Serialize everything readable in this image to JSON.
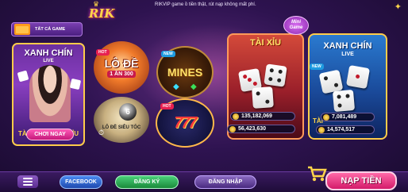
{
  "header": {
    "logo_text": "RIK",
    "ticker": "RIKVIP game ồ tiền thật, rút nạp không mất phí."
  },
  "tabs": {
    "all_games": "TẤT CẢ GAME"
  },
  "games": {
    "xanh_chin_live": {
      "title": "XANH CHÍN",
      "subtitle": "LIVE",
      "tai": "TÀI",
      "xiu": "XỈU",
      "play": "CHƠI NGAY"
    },
    "lo_de": {
      "badge": "HOT",
      "title": "LÔ ĐỀ",
      "subtitle": "1 ĂN 300"
    },
    "mines": {
      "badge": "NEW",
      "title": "MINES"
    },
    "lo_de_sieu_toc": {
      "ball": "6",
      "label": "LÔ ĐỀ SIÊU TỐC"
    },
    "slot_777": {
      "badge": "HOT",
      "title": "777"
    },
    "tai_xiu": {
      "title": "TÀI XỈU",
      "jackpot_1": "135,182,069",
      "jackpot_2": "56,423,630"
    },
    "mini_game": {
      "label": "Mini Game"
    },
    "xanh_chin_live_2": {
      "badge": "NEW",
      "title": "XANH CHÍN",
      "subtitle": "LIVE",
      "tai": "TÀI",
      "jackpot_1": "7,081,489",
      "jackpot_2": "14,574,517"
    }
  },
  "bottom_bar": {
    "facebook": "FACEBOOK",
    "register": "ĐĂNG KÝ",
    "login": "ĐĂNG NHẬP",
    "deposit": "NẠP TIỀN"
  },
  "colors": {
    "accent_pink": "#d41a6a",
    "gold": "#ffd54a",
    "bg_purple": "#2e1350"
  }
}
